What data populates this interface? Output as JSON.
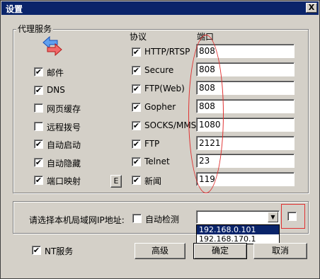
{
  "window": {
    "title": "设置",
    "close_glyph": "X"
  },
  "proxy_group": {
    "title": "代理服务",
    "protocol_header": "协议",
    "port_header": "端口",
    "left_options": [
      {
        "label": "邮件",
        "checked": true
      },
      {
        "label": "DNS",
        "checked": true
      },
      {
        "label": "网页缓存",
        "checked": false
      },
      {
        "label": "远程拨号",
        "checked": false
      },
      {
        "label": "自动启动",
        "checked": true
      },
      {
        "label": "自动隐藏",
        "checked": true
      },
      {
        "label": "端口映射",
        "checked": true
      }
    ],
    "port_map_button": "E",
    "protocols": [
      {
        "label": "HTTP/RTSP",
        "checked": true,
        "port": "808"
      },
      {
        "label": "Secure",
        "checked": true,
        "port": "808"
      },
      {
        "label": "FTP(Web)",
        "checked": true,
        "port": "808"
      },
      {
        "label": "Gopher",
        "checked": true,
        "port": "808"
      },
      {
        "label": "SOCKS/MMS",
        "checked": true,
        "port": "1080"
      },
      {
        "label": "FTP",
        "checked": true,
        "port": "2121"
      },
      {
        "label": "Telnet",
        "checked": true,
        "port": "23"
      },
      {
        "label": "新闻",
        "checked": true,
        "port": "119"
      }
    ],
    "proxy_icon": "two-arrows-icon"
  },
  "lan_group": {
    "prompt": "请选择本机局域网IP地址:",
    "auto_detect_label": "自动检测",
    "auto_detect_checked": false,
    "ip_combo_value": "",
    "ip_options": [
      "192.168.0.101",
      "192.168.170.1"
    ],
    "selected_index": 0,
    "extra_checked": false
  },
  "bottom": {
    "nt_service_label": "NT服务",
    "nt_service_checked": true,
    "advanced_button": "高级",
    "ok_button": "确定",
    "cancel_button": "取消"
  },
  "check_glyph": "✔",
  "colors": {
    "title_bar": "#0a246a",
    "dialog_bg": "#d4d0c8",
    "annotation_red": "#e03030"
  }
}
